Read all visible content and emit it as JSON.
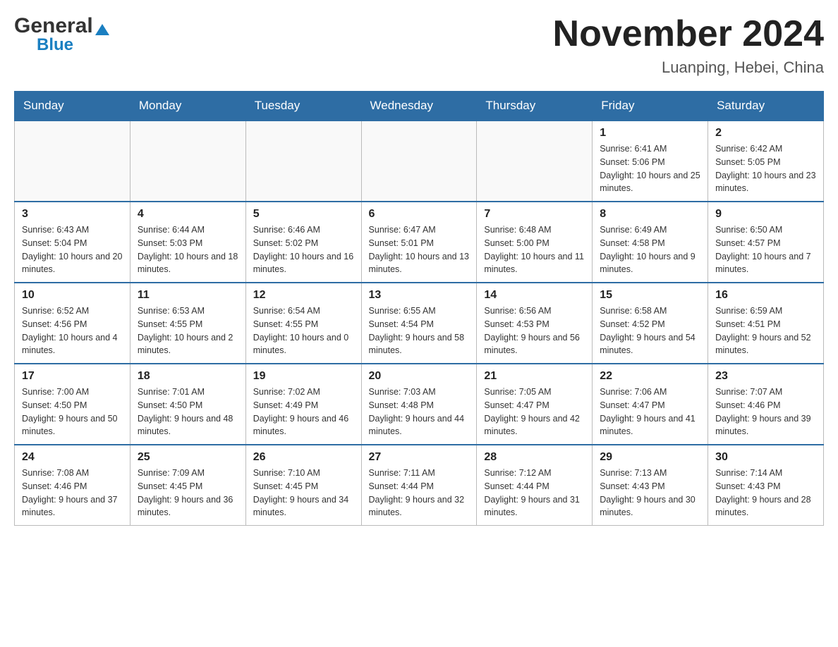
{
  "header": {
    "logo_general": "General",
    "logo_blue": "Blue",
    "title": "November 2024",
    "subtitle": "Luanping, Hebei, China"
  },
  "days_of_week": [
    "Sunday",
    "Monday",
    "Tuesday",
    "Wednesday",
    "Thursday",
    "Friday",
    "Saturday"
  ],
  "weeks": [
    [
      {
        "day": "",
        "sunrise": "",
        "sunset": "",
        "daylight": ""
      },
      {
        "day": "",
        "sunrise": "",
        "sunset": "",
        "daylight": ""
      },
      {
        "day": "",
        "sunrise": "",
        "sunset": "",
        "daylight": ""
      },
      {
        "day": "",
        "sunrise": "",
        "sunset": "",
        "daylight": ""
      },
      {
        "day": "",
        "sunrise": "",
        "sunset": "",
        "daylight": ""
      },
      {
        "day": "1",
        "sunrise": "Sunrise: 6:41 AM",
        "sunset": "Sunset: 5:06 PM",
        "daylight": "Daylight: 10 hours and 25 minutes."
      },
      {
        "day": "2",
        "sunrise": "Sunrise: 6:42 AM",
        "sunset": "Sunset: 5:05 PM",
        "daylight": "Daylight: 10 hours and 23 minutes."
      }
    ],
    [
      {
        "day": "3",
        "sunrise": "Sunrise: 6:43 AM",
        "sunset": "Sunset: 5:04 PM",
        "daylight": "Daylight: 10 hours and 20 minutes."
      },
      {
        "day": "4",
        "sunrise": "Sunrise: 6:44 AM",
        "sunset": "Sunset: 5:03 PM",
        "daylight": "Daylight: 10 hours and 18 minutes."
      },
      {
        "day": "5",
        "sunrise": "Sunrise: 6:46 AM",
        "sunset": "Sunset: 5:02 PM",
        "daylight": "Daylight: 10 hours and 16 minutes."
      },
      {
        "day": "6",
        "sunrise": "Sunrise: 6:47 AM",
        "sunset": "Sunset: 5:01 PM",
        "daylight": "Daylight: 10 hours and 13 minutes."
      },
      {
        "day": "7",
        "sunrise": "Sunrise: 6:48 AM",
        "sunset": "Sunset: 5:00 PM",
        "daylight": "Daylight: 10 hours and 11 minutes."
      },
      {
        "day": "8",
        "sunrise": "Sunrise: 6:49 AM",
        "sunset": "Sunset: 4:58 PM",
        "daylight": "Daylight: 10 hours and 9 minutes."
      },
      {
        "day": "9",
        "sunrise": "Sunrise: 6:50 AM",
        "sunset": "Sunset: 4:57 PM",
        "daylight": "Daylight: 10 hours and 7 minutes."
      }
    ],
    [
      {
        "day": "10",
        "sunrise": "Sunrise: 6:52 AM",
        "sunset": "Sunset: 4:56 PM",
        "daylight": "Daylight: 10 hours and 4 minutes."
      },
      {
        "day": "11",
        "sunrise": "Sunrise: 6:53 AM",
        "sunset": "Sunset: 4:55 PM",
        "daylight": "Daylight: 10 hours and 2 minutes."
      },
      {
        "day": "12",
        "sunrise": "Sunrise: 6:54 AM",
        "sunset": "Sunset: 4:55 PM",
        "daylight": "Daylight: 10 hours and 0 minutes."
      },
      {
        "day": "13",
        "sunrise": "Sunrise: 6:55 AM",
        "sunset": "Sunset: 4:54 PM",
        "daylight": "Daylight: 9 hours and 58 minutes."
      },
      {
        "day": "14",
        "sunrise": "Sunrise: 6:56 AM",
        "sunset": "Sunset: 4:53 PM",
        "daylight": "Daylight: 9 hours and 56 minutes."
      },
      {
        "day": "15",
        "sunrise": "Sunrise: 6:58 AM",
        "sunset": "Sunset: 4:52 PM",
        "daylight": "Daylight: 9 hours and 54 minutes."
      },
      {
        "day": "16",
        "sunrise": "Sunrise: 6:59 AM",
        "sunset": "Sunset: 4:51 PM",
        "daylight": "Daylight: 9 hours and 52 minutes."
      }
    ],
    [
      {
        "day": "17",
        "sunrise": "Sunrise: 7:00 AM",
        "sunset": "Sunset: 4:50 PM",
        "daylight": "Daylight: 9 hours and 50 minutes."
      },
      {
        "day": "18",
        "sunrise": "Sunrise: 7:01 AM",
        "sunset": "Sunset: 4:50 PM",
        "daylight": "Daylight: 9 hours and 48 minutes."
      },
      {
        "day": "19",
        "sunrise": "Sunrise: 7:02 AM",
        "sunset": "Sunset: 4:49 PM",
        "daylight": "Daylight: 9 hours and 46 minutes."
      },
      {
        "day": "20",
        "sunrise": "Sunrise: 7:03 AM",
        "sunset": "Sunset: 4:48 PM",
        "daylight": "Daylight: 9 hours and 44 minutes."
      },
      {
        "day": "21",
        "sunrise": "Sunrise: 7:05 AM",
        "sunset": "Sunset: 4:47 PM",
        "daylight": "Daylight: 9 hours and 42 minutes."
      },
      {
        "day": "22",
        "sunrise": "Sunrise: 7:06 AM",
        "sunset": "Sunset: 4:47 PM",
        "daylight": "Daylight: 9 hours and 41 minutes."
      },
      {
        "day": "23",
        "sunrise": "Sunrise: 7:07 AM",
        "sunset": "Sunset: 4:46 PM",
        "daylight": "Daylight: 9 hours and 39 minutes."
      }
    ],
    [
      {
        "day": "24",
        "sunrise": "Sunrise: 7:08 AM",
        "sunset": "Sunset: 4:46 PM",
        "daylight": "Daylight: 9 hours and 37 minutes."
      },
      {
        "day": "25",
        "sunrise": "Sunrise: 7:09 AM",
        "sunset": "Sunset: 4:45 PM",
        "daylight": "Daylight: 9 hours and 36 minutes."
      },
      {
        "day": "26",
        "sunrise": "Sunrise: 7:10 AM",
        "sunset": "Sunset: 4:45 PM",
        "daylight": "Daylight: 9 hours and 34 minutes."
      },
      {
        "day": "27",
        "sunrise": "Sunrise: 7:11 AM",
        "sunset": "Sunset: 4:44 PM",
        "daylight": "Daylight: 9 hours and 32 minutes."
      },
      {
        "day": "28",
        "sunrise": "Sunrise: 7:12 AM",
        "sunset": "Sunset: 4:44 PM",
        "daylight": "Daylight: 9 hours and 31 minutes."
      },
      {
        "day": "29",
        "sunrise": "Sunrise: 7:13 AM",
        "sunset": "Sunset: 4:43 PM",
        "daylight": "Daylight: 9 hours and 30 minutes."
      },
      {
        "day": "30",
        "sunrise": "Sunrise: 7:14 AM",
        "sunset": "Sunset: 4:43 PM",
        "daylight": "Daylight: 9 hours and 28 minutes."
      }
    ]
  ]
}
